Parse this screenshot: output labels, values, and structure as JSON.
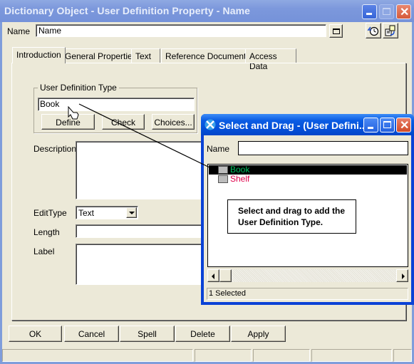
{
  "window": {
    "title": "Dictionary Object - User Definition Property - Name",
    "minimize_label": "_",
    "maximize_label": "□",
    "close_label": "✕"
  },
  "name_row": {
    "label": "Name",
    "value": "Name",
    "expand_icon": "window-icon",
    "history_icon": "history-icon",
    "properties_icon": "properties-icon"
  },
  "tabs": [
    {
      "label": "Introduction",
      "active": true
    },
    {
      "label": "General Properties",
      "active": false
    },
    {
      "label": "Text",
      "active": false
    },
    {
      "label": "Reference Documents",
      "active": false
    },
    {
      "label": "Access Data",
      "active": false
    }
  ],
  "user_definition_type": {
    "group_label": "User Definition Type",
    "value": "Book",
    "define_label": "Define",
    "check_label": "Check",
    "choices_label": "Choices..."
  },
  "form": {
    "description_label": "Description",
    "description_value": "",
    "edittype_label": "EditType",
    "edittype_value": "Text",
    "length_label": "Length",
    "length_value": "",
    "label_label": "Label",
    "label_value": ""
  },
  "footer_buttons": {
    "ok": "OK",
    "cancel": "Cancel",
    "spell": "Spell",
    "delete": "Delete",
    "apply": "Apply"
  },
  "popup": {
    "title": "Select and Drag - (User Defini...",
    "name_label": "Name",
    "name_value": "",
    "items": [
      {
        "label": "Book",
        "color": "#00c060",
        "selected": true
      },
      {
        "label": "Shelf",
        "color": "#e0004a",
        "selected": false
      }
    ],
    "callout": "Select and drag to add the User Definition Type.",
    "status": "1 Selected"
  }
}
